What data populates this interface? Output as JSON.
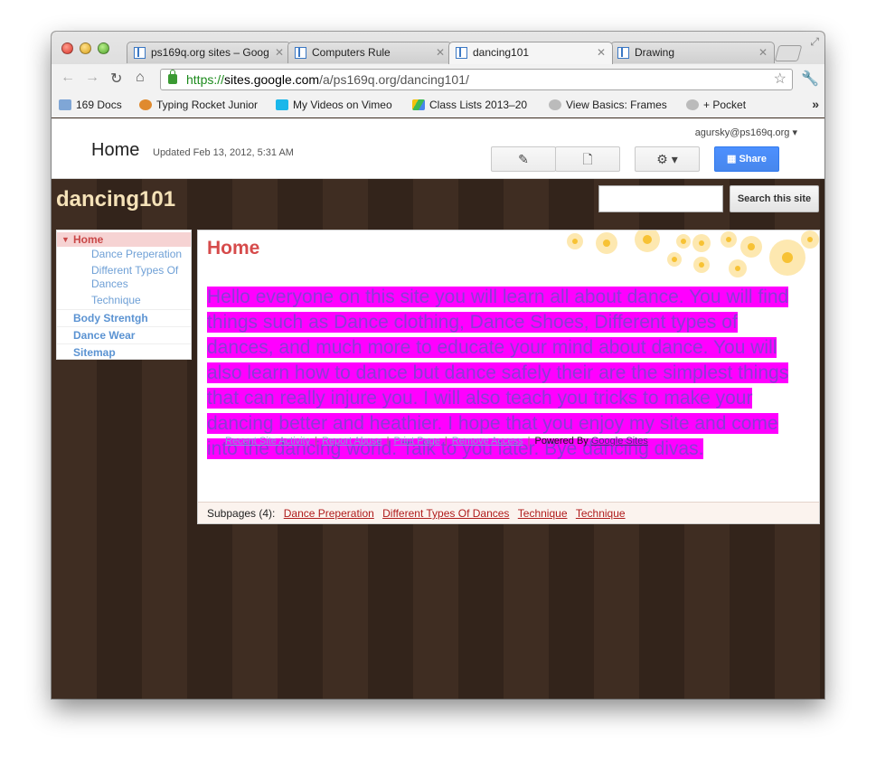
{
  "browser": {
    "tabs": [
      {
        "title": "ps169q.org sites – Goog"
      },
      {
        "title": "Computers Rule"
      },
      {
        "title": "dancing101"
      },
      {
        "title": "Drawing"
      }
    ],
    "url": {
      "scheme": "https://",
      "host": "sites.google.com",
      "path": "/a/ps169q.org/dancing101/"
    },
    "bookmarks": [
      {
        "label": "169 Docs"
      },
      {
        "label": "Typing Rocket Junior"
      },
      {
        "label": "My Videos on Vimeo"
      },
      {
        "label": "Class Lists 2013–20"
      },
      {
        "label": "View Basics: Frames"
      },
      {
        "label": "+ Pocket"
      }
    ]
  },
  "header": {
    "page_title": "Home",
    "updated": "Updated Feb 13, 2012, 5:31 AM",
    "user_email": "agursky@ps169q.org",
    "share_label": "Share"
  },
  "site": {
    "name": "dancing101",
    "search_button": "Search this site"
  },
  "sidebar": {
    "home": "Home",
    "sub_items": [
      "Dance Preperation",
      "Different Types Of Dances",
      "Technique"
    ],
    "top_items": [
      "Body Strentgh",
      "Dance Wear",
      "Sitemap"
    ]
  },
  "content": {
    "heading": "Home",
    "body": "Hello everyone on this site you will learn all about dance. You will find things such as Dance clothing, Dance Shoes, Different types of dances, and much more to educate your mind about dance. You will also learn how to dance but dance safely their are the simplest things that can really injure you. I will also teach you tricks to make your dancing better and heathier. I hope that you enjoy my site and come into the dancing world. Talk to you later. Bye dancing divas.",
    "subpages_label": "Subpages (4):",
    "subpages": [
      "Dance Preperation",
      "Different Types Of Dances",
      "Technique",
      "Technique"
    ]
  },
  "footer": {
    "links": [
      "Recent Site Activity",
      "Report Abuse",
      "Print Page",
      "Remove Access"
    ],
    "powered_by": "Powered By",
    "google_sites": "Google Sites"
  }
}
